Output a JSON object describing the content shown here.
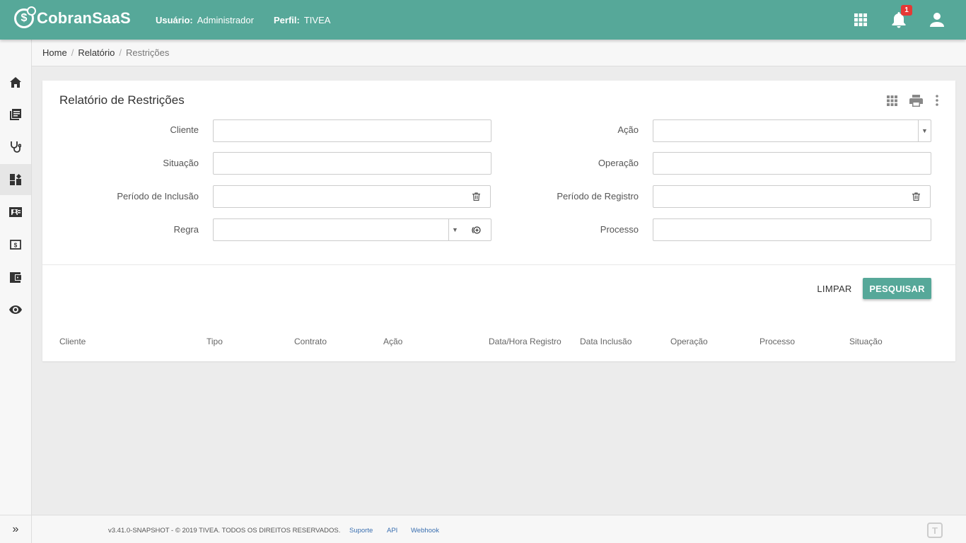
{
  "header": {
    "brand": "CobranSaaS",
    "user_label": "Usuário:",
    "user_value": "Administrador",
    "profile_label": "Perfil:",
    "profile_value": "TIVEA",
    "notification_count": "1",
    "icons": [
      "apps-grid-icon",
      "bell-icon",
      "user-icon"
    ],
    "accent_color": "#56a899"
  },
  "sidebar": {
    "items": [
      {
        "icon": "home-icon"
      },
      {
        "icon": "library-books-icon"
      },
      {
        "icon": "stethoscope-icon"
      },
      {
        "icon": "dashboard-icon",
        "active": true
      },
      {
        "icon": "contact-card-icon"
      },
      {
        "icon": "money-icon"
      },
      {
        "icon": "wallet-icon"
      },
      {
        "icon": "eye-icon"
      }
    ],
    "expand_label": "»"
  },
  "breadcrumb": {
    "items": [
      "Home",
      "Relatório"
    ],
    "current": "Restrições"
  },
  "form": {
    "title": "Relatório de Restrições",
    "fields": {
      "cliente": {
        "label": "Cliente",
        "value": ""
      },
      "situacao": {
        "label": "Situação",
        "value": ""
      },
      "periodo_inclusao": {
        "label": "Período de Inclusão",
        "value": ""
      },
      "regra": {
        "label": "Regra",
        "value": ""
      },
      "acao": {
        "label": "Ação",
        "value": ""
      },
      "operacao": {
        "label": "Operação",
        "value": ""
      },
      "periodo_registro": {
        "label": "Período de Registro",
        "value": ""
      },
      "processo": {
        "label": "Processo",
        "value": ""
      }
    },
    "clear_label": "LIMPAR",
    "search_label": "PESQUISAR"
  },
  "table": {
    "columns": [
      "Cliente",
      "Tipo",
      "Contrato",
      "Ação",
      "Data/Hora Registro",
      "Data Inclusão",
      "Operação",
      "Processo",
      "Situação"
    ],
    "rows": []
  },
  "footer": {
    "version": "v3.41.0-SNAPSHOT - © 2019 TIVEA. TODOS OS DIREITOS RESERVADOS.",
    "links": [
      "Suporte",
      "API",
      "Webhook"
    ],
    "logo_text": "T"
  }
}
